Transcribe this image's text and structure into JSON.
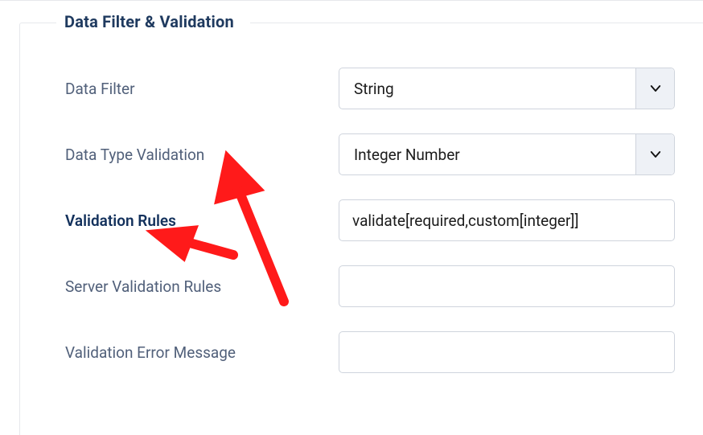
{
  "section_title": "Data Filter & Validation",
  "fields": {
    "data_filter": {
      "label": "Data Filter",
      "value": "String"
    },
    "data_type_validation": {
      "label": "Data Type Validation",
      "value": "Integer Number"
    },
    "validation_rules": {
      "label": "Validation Rules",
      "value": "validate[required,custom[integer]]"
    },
    "server_validation_rules": {
      "label": "Server Validation Rules",
      "value": ""
    },
    "validation_error_message": {
      "label": "Validation Error Message",
      "value": ""
    }
  },
  "annotations": {
    "arrow_color": "#ff1a1a"
  }
}
